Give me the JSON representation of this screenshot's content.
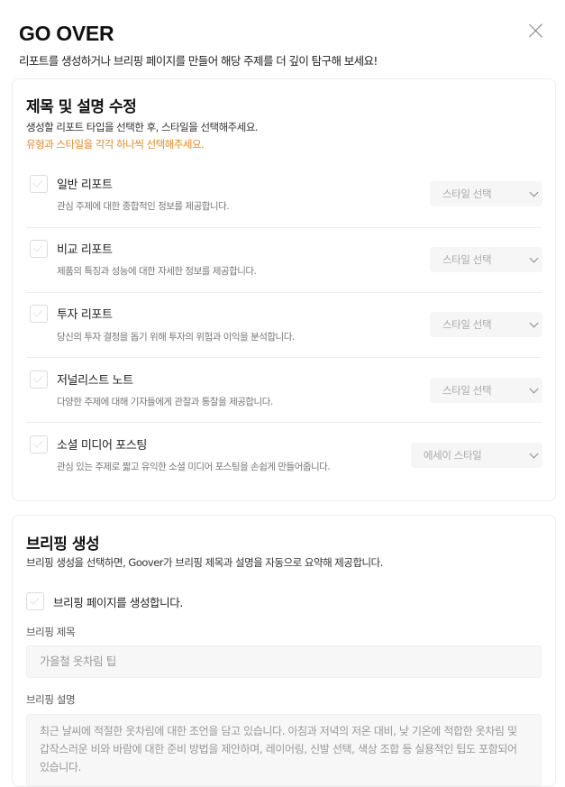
{
  "header": {
    "title": "GO OVER",
    "subtitle": "리포트를 생성하거나 브리핑 페이지를 만들어 해당 주제를 더 깊이 탐구해 보세요!"
  },
  "report_section": {
    "title": "제목 및 설명 수정",
    "desc": "생성할 리포트 타입을 선택한 후, 스타일을 선택해주세요.",
    "warning": "유형과 스타일을 각각 하나씩 선택해주세요.",
    "items": [
      {
        "name": "일반 리포트",
        "desc": "관심 주제에 대한 종합적인 정보를 제공합니다.",
        "style": "스타일 선택",
        "checked": false
      },
      {
        "name": "비교 리포트",
        "desc": "제품의 특징과 성능에 대한 자세한 정보를 제공합니다.",
        "style": "스타일 선택",
        "checked": false
      },
      {
        "name": "투자 리포트",
        "desc": "당신의 투자 결정을 돕기 위해 투자의 위험과 이익을 분석합니다.",
        "style": "스타일 선택",
        "checked": false
      },
      {
        "name": "저널리스트 노트",
        "desc": "다양한 주제에 대해 기자들에게 관찰과 통찰을 제공합니다.",
        "style": "스타일 선택",
        "checked": false
      },
      {
        "name": "소셜 미디어 포스팅",
        "desc": "관심 있는 주제로 짧고 유익한 소셜 미디어 포스팅을 손쉽게 만들어줍니다.",
        "style": "에세이 스타일",
        "checked": false
      }
    ]
  },
  "briefing_section": {
    "title": "브리핑 생성",
    "desc": "브리핑 생성을 선택하면, Goover가 브리핑 제목과 설명을 자동으로 요약해 제공합니다.",
    "checkbox_label": "브리핑 페이지를 생성합니다.",
    "title_label": "브리핑 제목",
    "title_value": "가을철 옷차림 팁",
    "desc_label": "브리핑 설명",
    "desc_value": "최근 날씨에 적절한 옷차림에 대한 조언을 담고 있습니다. 아침과 저녁의 저온 대비, 낮 기온에 적합한 옷차림 및 갑작스러운 비와 바람에 대한 준비 방법을 제안하며, 레이어링, 신발 선택, 색상 조합 등 실용적인 팁도 포함되어 있습니다."
  }
}
